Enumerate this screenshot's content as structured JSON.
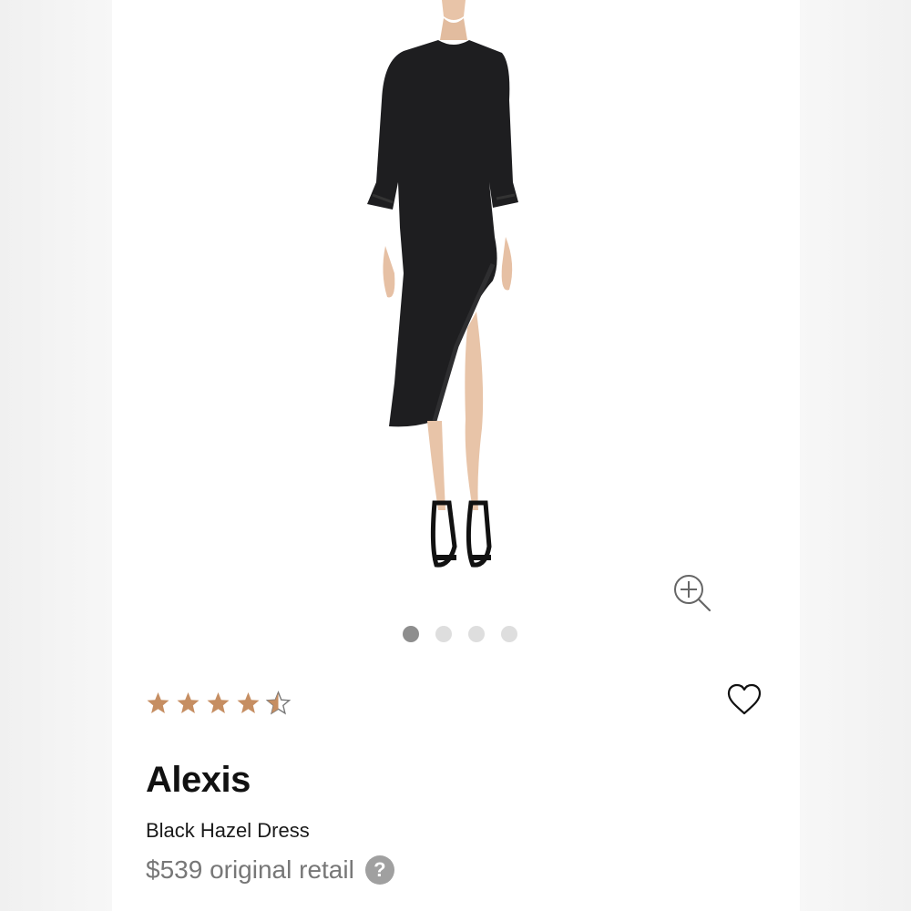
{
  "product": {
    "brand": "Alexis",
    "name": "Black Hazel Dress",
    "price": "$539 original retail",
    "help_icon_text": "?",
    "rating": 4.5,
    "rating_max": 5
  },
  "gallery": {
    "image_count": 4,
    "active_index": 0
  },
  "icons": {
    "zoom": "zoom-in-icon",
    "favorite": "heart-outline-icon",
    "help": "question-mark-icon"
  },
  "colors": {
    "star": "#c68e62",
    "dot_active": "#8e8e8e",
    "dot_inactive": "#dedede",
    "price": "#777777"
  }
}
